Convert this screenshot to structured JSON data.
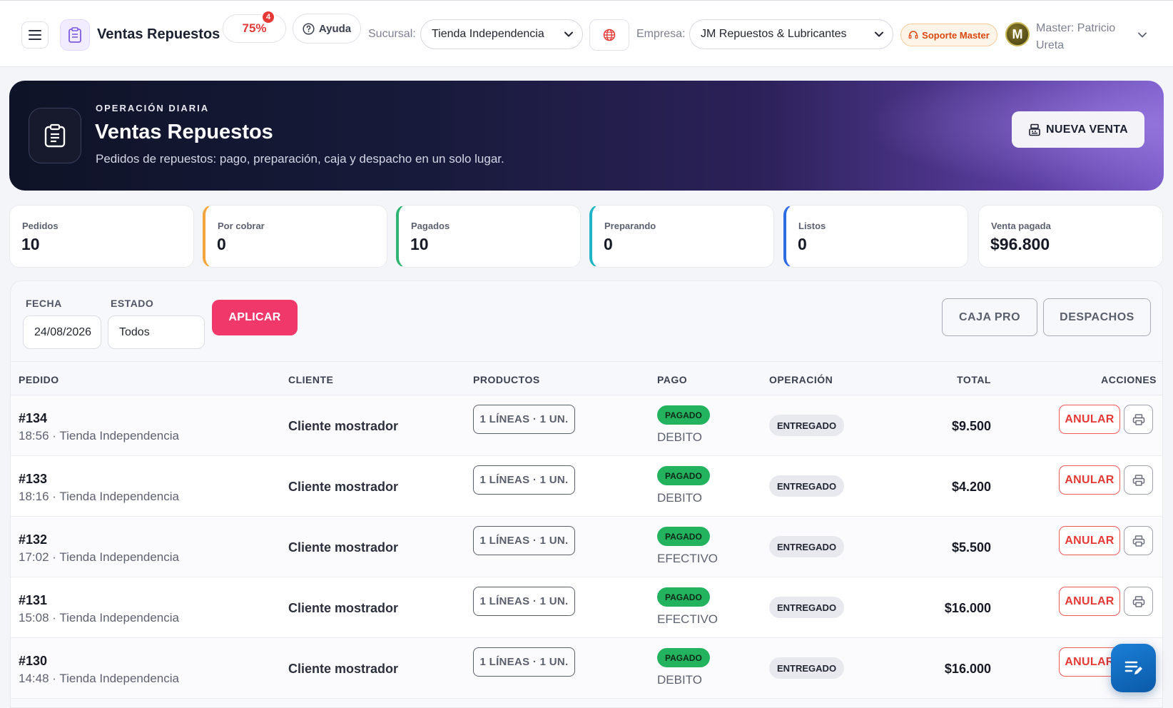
{
  "topbar": {
    "app_title": "Ventas Repuestos",
    "progress": "75%",
    "notification_count": "4",
    "help_label": "Ayuda",
    "branch_label": "Sucursal:",
    "branch_value": "Tienda Independencia",
    "company_label": "Empresa:",
    "company_value": "JM Repuestos & Lubricantes",
    "support_label": "Soporte Master",
    "avatar_initial": "M",
    "user_line1": "Master: Patricio",
    "user_line2": "Ureta"
  },
  "hero": {
    "eyebrow": "OPERACIÓN DIARIA",
    "title": "Ventas Repuestos",
    "subtitle": "Pedidos de repuestos: pago, preparación, caja y despacho en un solo lugar.",
    "new_sale_label": "NUEVA VENTA"
  },
  "stats": [
    {
      "label": "Pedidos",
      "value": "10"
    },
    {
      "label": "Por cobrar",
      "value": "0"
    },
    {
      "label": "Pagados",
      "value": "10"
    },
    {
      "label": "Preparando",
      "value": "0"
    },
    {
      "label": "Listos",
      "value": "0"
    },
    {
      "label": "Venta pagada",
      "value": "$96.800"
    }
  ],
  "filters": {
    "date_label": "FECHA",
    "date_value": "24/08/2026",
    "status_label": "ESTADO",
    "status_value": "Todos",
    "apply_label": "APLICAR",
    "cash_label": "CAJA PRO",
    "dispatch_label": "DESPACHOS"
  },
  "table": {
    "headers": [
      "PEDIDO",
      "CLIENTE",
      "PRODUCTOS",
      "PAGO",
      "OPERACIÓN",
      "TOTAL",
      "ACCIONES"
    ],
    "cancel_label": "ANULAR",
    "rows": [
      {
        "id": "#134",
        "meta": "18:56 · Tienda Independencia",
        "client": "Cliente mostrador",
        "products": "1 LÍNEAS · 1 UN.",
        "pay_status": "PAGADO",
        "pay_method": "DEBITO",
        "operation": "ENTREGADO",
        "total": "$9.500"
      },
      {
        "id": "#133",
        "meta": "18:16 · Tienda Independencia",
        "client": "Cliente mostrador",
        "products": "1 LÍNEAS · 1 UN.",
        "pay_status": "PAGADO",
        "pay_method": "DEBITO",
        "operation": "ENTREGADO",
        "total": "$4.200"
      },
      {
        "id": "#132",
        "meta": "17:02 · Tienda Independencia",
        "client": "Cliente mostrador",
        "products": "1 LÍNEAS · 1 UN.",
        "pay_status": "PAGADO",
        "pay_method": "EFECTIVO",
        "operation": "ENTREGADO",
        "total": "$5.500"
      },
      {
        "id": "#131",
        "meta": "15:08 · Tienda Independencia",
        "client": "Cliente mostrador",
        "products": "1 LÍNEAS · 1 UN.",
        "pay_status": "PAGADO",
        "pay_method": "EFECTIVO",
        "operation": "ENTREGADO",
        "total": "$16.000"
      },
      {
        "id": "#130",
        "meta": "14:48 · Tienda Independencia",
        "client": "Cliente mostrador",
        "products": "1 LÍNEAS · 1 UN.",
        "pay_status": "PAGADO",
        "pay_method": "DEBITO",
        "operation": "ENTREGADO",
        "total": "$16.000"
      }
    ]
  }
}
